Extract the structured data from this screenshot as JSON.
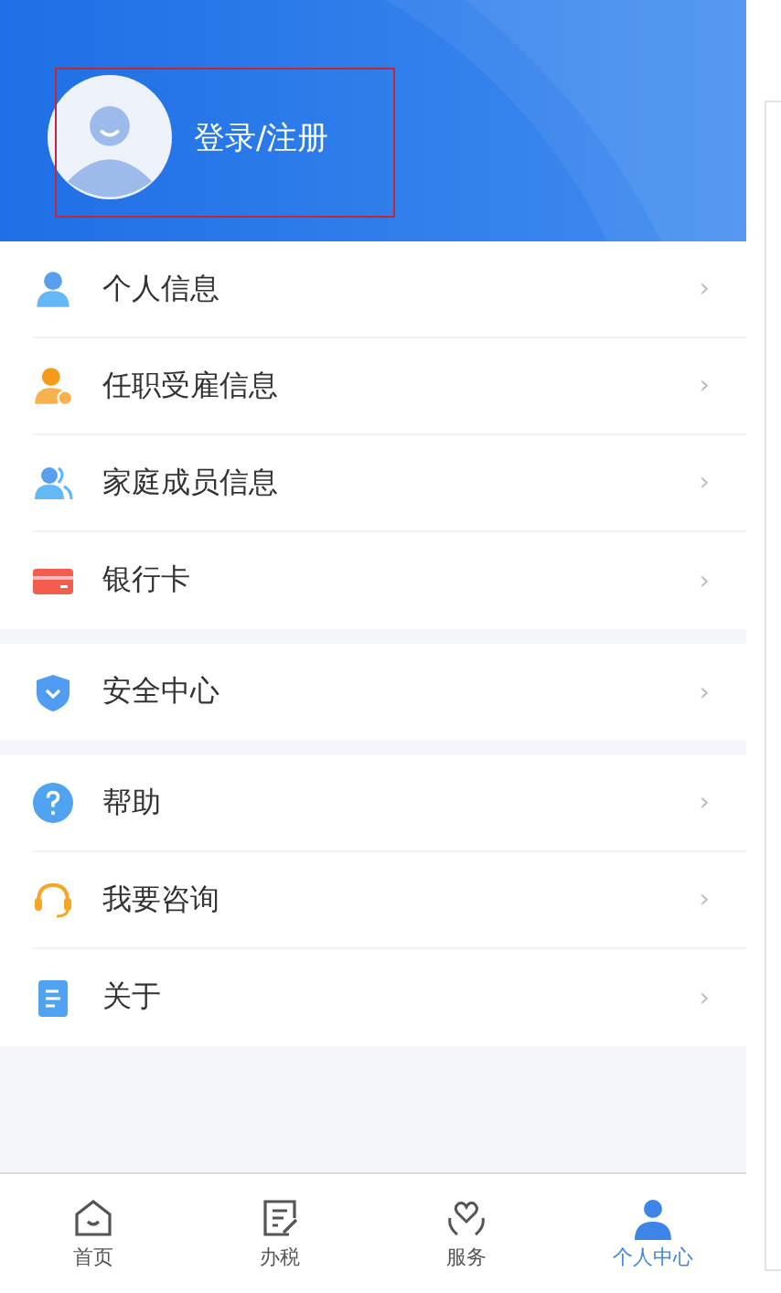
{
  "profile": {
    "login_label": "登录/注册"
  },
  "menu_groups": [
    {
      "items": [
        {
          "kind": "person",
          "label": "个人信息",
          "chevron": "›"
        },
        {
          "kind": "employment",
          "label": "任职受雇信息",
          "chevron": "›"
        },
        {
          "kind": "family",
          "label": "家庭成员信息",
          "chevron": "›"
        },
        {
          "kind": "card",
          "label": "银行卡",
          "chevron": "›"
        }
      ]
    },
    {
      "items": [
        {
          "kind": "shield",
          "label": "安全中心",
          "chevron": "›"
        }
      ]
    },
    {
      "items": [
        {
          "kind": "help",
          "label": "帮助",
          "chevron": "›"
        },
        {
          "kind": "headset",
          "label": "我要咨询",
          "chevron": "›"
        },
        {
          "kind": "document",
          "label": "关于",
          "chevron": "›"
        }
      ]
    }
  ],
  "tab_bar": [
    {
      "kind": "home",
      "label": "首页",
      "selected": false
    },
    {
      "kind": "tax",
      "label": "办税",
      "selected": false
    },
    {
      "kind": "service",
      "label": "服务",
      "selected": false
    },
    {
      "kind": "profile",
      "label": "个人中心",
      "selected": true
    }
  ]
}
